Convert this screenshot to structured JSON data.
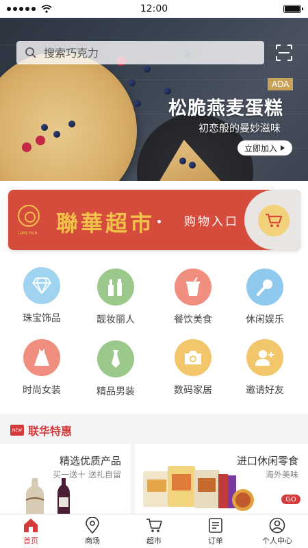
{
  "status_bar": {
    "time": "12:00"
  },
  "search": {
    "placeholder": "搜索巧克力",
    "scan_icon": "scan-icon"
  },
  "banner": {
    "brand_tag": "ADA",
    "headline": "松脆燕麦蛋糕",
    "subline": "初恋般的曼妙滋味",
    "cta": "立即加入",
    "page_count": 5,
    "active_page": 1
  },
  "supermarket": {
    "logo_small": "LIAN HUA",
    "logo_text": "聯華超市",
    "entry_label": "购物入口",
    "icon": "cart-icon"
  },
  "categories": [
    {
      "label": "珠宝饰品",
      "icon": "diamond-icon",
      "color": "#9fd3ef"
    },
    {
      "label": "靓妆丽人",
      "icon": "cosmetics-icon",
      "color": "#9bc98b"
    },
    {
      "label": "餐饮美食",
      "icon": "drink-icon",
      "color": "#f08f80"
    },
    {
      "label": "休闲娱乐",
      "icon": "microphone-icon",
      "color": "#8fc9ee"
    },
    {
      "label": "时尚女装",
      "icon": "dress-icon",
      "color": "#f08f80"
    },
    {
      "label": "精品男装",
      "icon": "tie-icon",
      "color": "#9bc98b"
    },
    {
      "label": "数码家居",
      "icon": "camera-icon",
      "color": "#f2c66a"
    },
    {
      "label": "邀请好友",
      "icon": "add-friend-icon",
      "color": "#f2c66a"
    }
  ],
  "promo": {
    "badge": "NEW",
    "title": "联华特惠",
    "left_card": {
      "title": "精选优质产品",
      "subtitle": "买一送十  送礼自留"
    },
    "right_card": {
      "title": "进口休闲零食",
      "subtitle": "海外美味",
      "go": "GO"
    }
  },
  "tabbar": [
    {
      "label": "首页",
      "icon": "home-icon",
      "active": true
    },
    {
      "label": "商场",
      "icon": "location-icon",
      "active": false
    },
    {
      "label": "超市",
      "icon": "cart-icon",
      "active": false
    },
    {
      "label": "订单",
      "icon": "order-icon",
      "active": false
    },
    {
      "label": "个人中心",
      "icon": "user-icon",
      "active": false
    }
  ],
  "colors": {
    "accent": "#d63b3b",
    "gold": "#f2c14a",
    "banner_tag": "#c8a25a"
  }
}
